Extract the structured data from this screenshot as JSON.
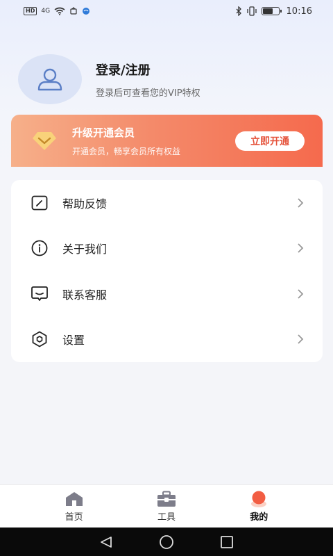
{
  "status_bar": {
    "hd": "HD",
    "net": "4G",
    "time": "10:16",
    "battery_level": 0.6
  },
  "profile": {
    "title": "登录/注册",
    "subtitle": "登录后可查看您的VIP特权"
  },
  "vip": {
    "title": "升级开通会员",
    "subtitle": "开通会员，畅享会员所有权益",
    "button": "立即开通"
  },
  "menu": {
    "items": [
      {
        "label": "帮助反馈",
        "icon": "edit-feedback-icon"
      },
      {
        "label": "关于我们",
        "icon": "info-icon"
      },
      {
        "label": "联系客服",
        "icon": "chat-bubble-icon"
      },
      {
        "label": "设置",
        "icon": "settings-hexagon-icon"
      }
    ]
  },
  "tabbar": {
    "items": [
      {
        "label": "首页",
        "icon": "home-icon"
      },
      {
        "label": "工具",
        "icon": "toolbox-icon"
      },
      {
        "label": "我的",
        "icon": "profile-blob-icon"
      }
    ],
    "active": "我的"
  },
  "colors": {
    "accent": "#f56a4d",
    "vip_gradient_start": "#f6b08a",
    "vip_button_text": "#e5523a",
    "avatar_bg": "#dbe3f6",
    "page_bg": "#f4f5f9"
  }
}
